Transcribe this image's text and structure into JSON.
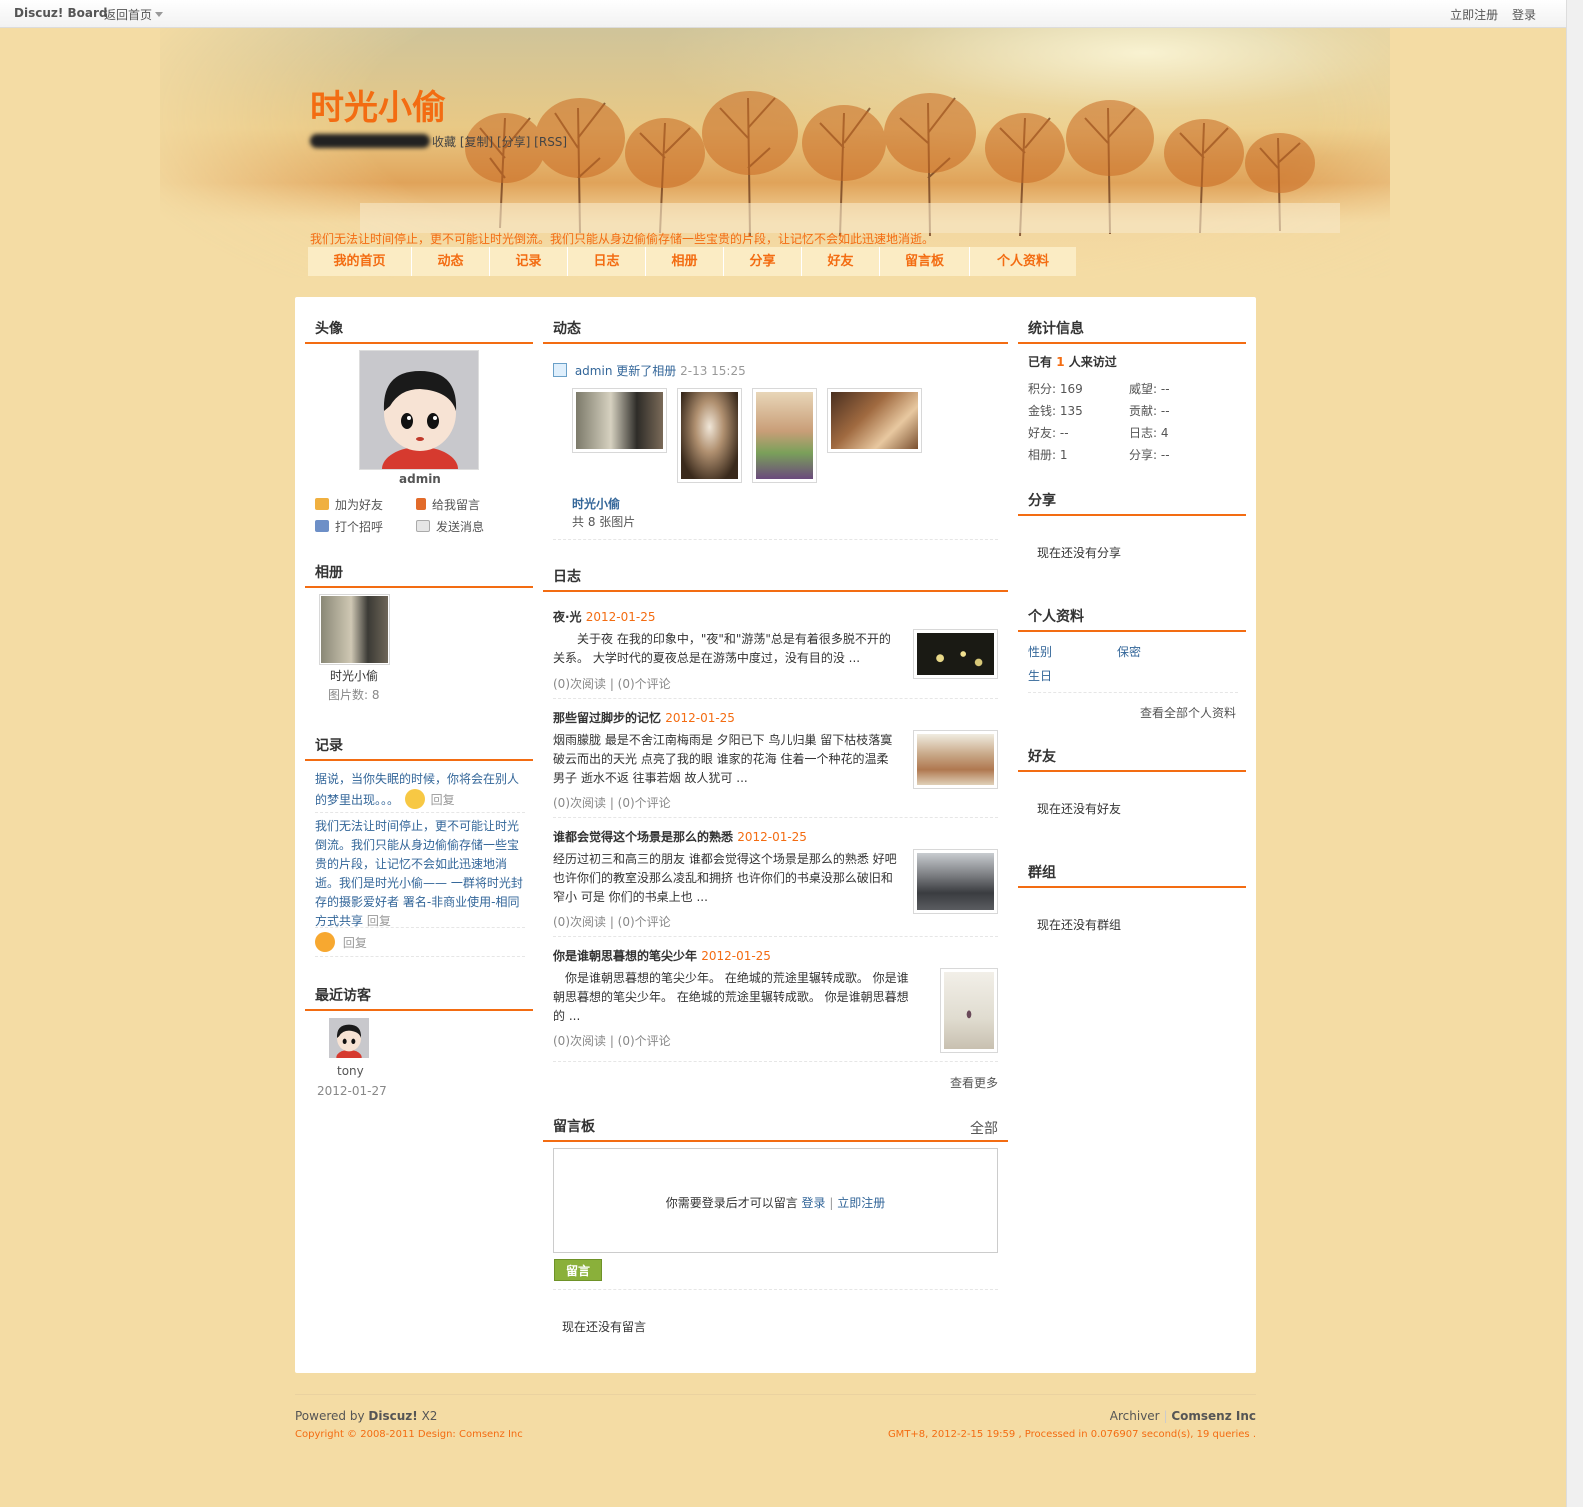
{
  "topbar": {
    "brand": "Discuz! Board",
    "home": "返回首页",
    "register": "立即注册",
    "login": "登录"
  },
  "header": {
    "title": "时光小偷",
    "links": "收藏 [复制] [分享] [RSS]",
    "slogan": "我们无法让时间停止，更不可能让时光倒流。我们只能从身边偷偷存储一些宝贵的片段，让记忆不会如此迅速地消逝。"
  },
  "nav": {
    "items": [
      "我的首页",
      "动态",
      "记录",
      "日志",
      "相册",
      "分享",
      "好友",
      "留言板",
      "个人资料"
    ]
  },
  "left": {
    "avatar_heading": "头像",
    "username": "admin",
    "actions": {
      "add_friend": "加为好友",
      "leave_message": "给我留言",
      "greet": "打个招呼",
      "send_message": "发送消息"
    },
    "album_heading": "相册",
    "album_name": "时光小偷",
    "album_count": "图片数: 8",
    "records_heading": "记录",
    "record1": "据说，当你失眠的时候，你将会在别人的梦里出现。。。",
    "record2": "我们无法让时间停止，更不可能让时光倒流。我们只能从身边偷偷存储一些宝贵的片段，让记忆不会如此迅速地消逝。我们是时光小偷—— 一群将时光封存的摄影爱好者 署名-非商业使用-相同方式共享",
    "reply": "回复",
    "visitors_heading": "最近访客",
    "visitor_name": "tony",
    "visitor_date": "2012-01-27"
  },
  "center": {
    "feed_heading": "动态",
    "feed_user": "admin",
    "feed_action": "更新了相册",
    "feed_time": "2-13 15:25",
    "feed_album": "时光小偷",
    "feed_count": "共 8 张图片",
    "blog_heading": "日志",
    "blogs": [
      {
        "title": "夜·光",
        "date": "2012-01-25",
        "text": "　　关于夜 在我的印象中，\"夜\"和\"游荡\"总是有着很多脱不开的关系。 大学时代的夏夜总是在游荡中度过，没有目的没 ...",
        "reads": "(0)次阅读",
        "comments": "(0)个评论"
      },
      {
        "title": "那些留过脚步的记忆",
        "date": "2012-01-25",
        "text": "烟雨朦胧 最是不舍江南梅雨是 夕阳已下 鸟儿归巢 留下枯枝落寞 破云而出的天光 点亮了我的眼 谁家的花海 住着一个种花的温柔男子 逝水不返 往事若烟 故人犹可 ...",
        "reads": "(0)次阅读",
        "comments": "(0)个评论"
      },
      {
        "title": "谁都会觉得这个场景是那么的熟悉",
        "date": "2012-01-25",
        "text": "经历过初三和高三的朋友 谁都会觉得这个场景是那么的熟悉 好吧 也许你们的教室没那么凌乱和拥挤 也许你们的书桌没那么破旧和窄小 可是 你们的书桌上也 ...",
        "reads": "(0)次阅读",
        "comments": "(0)个评论"
      },
      {
        "title": "你是谁朝思暮想的笔尖少年",
        "date": "2012-01-25",
        "text": "　你是谁朝思暮想的笔尖少年。 在绝城的荒途里辗转成歌。 你是谁朝思暮想的笔尖少年。 在绝城的荒途里辗转成歌。 你是谁朝思暮想的 ...",
        "reads": "(0)次阅读",
        "comments": "(0)个评论"
      }
    ],
    "more": "查看更多",
    "board_heading": "留言板",
    "board_all": "全部",
    "board_notice": "你需要登录后才可以留言",
    "board_login": "登录",
    "board_register": "立即注册",
    "board_button": "留言",
    "board_empty": "现在还没有留言"
  },
  "right": {
    "stats_heading": "统计信息",
    "visits_prefix": "已有",
    "visits_count": "1",
    "visits_suffix": "人来访过",
    "stats": [
      {
        "label": "积分: 169"
      },
      {
        "label": "威望: --"
      },
      {
        "label": "金钱: 135"
      },
      {
        "label": "贡献: --"
      },
      {
        "label": "好友: --"
      },
      {
        "label": "日志: 4"
      },
      {
        "label": "相册: 1"
      },
      {
        "label": "分享: --"
      }
    ],
    "share_heading": "分享",
    "share_empty": "现在还没有分享",
    "profile_heading": "个人资料",
    "gender_label": "性别",
    "gender_value": "保密",
    "birthday_label": "生日",
    "profile_more": "查看全部个人资料",
    "friends_heading": "好友",
    "friends_empty": "现在还没有好友",
    "groups_heading": "群组",
    "groups_empty": "现在还没有群组"
  },
  "footer": {
    "powered": "Powered by",
    "product": "Discuz!",
    "version": "X2",
    "copyright": "Copyright © 2008-2011 Design: Comsenz Inc",
    "archiver": "Archiver",
    "company": "Comsenz Inc",
    "stats": "GMT+8, 2012-2-15 19:59 , Processed in 0.076907 second(s), 19 queries ."
  },
  "colors": {
    "accent": "#f36c12",
    "background": "#f4dca4",
    "link": "#336699"
  }
}
